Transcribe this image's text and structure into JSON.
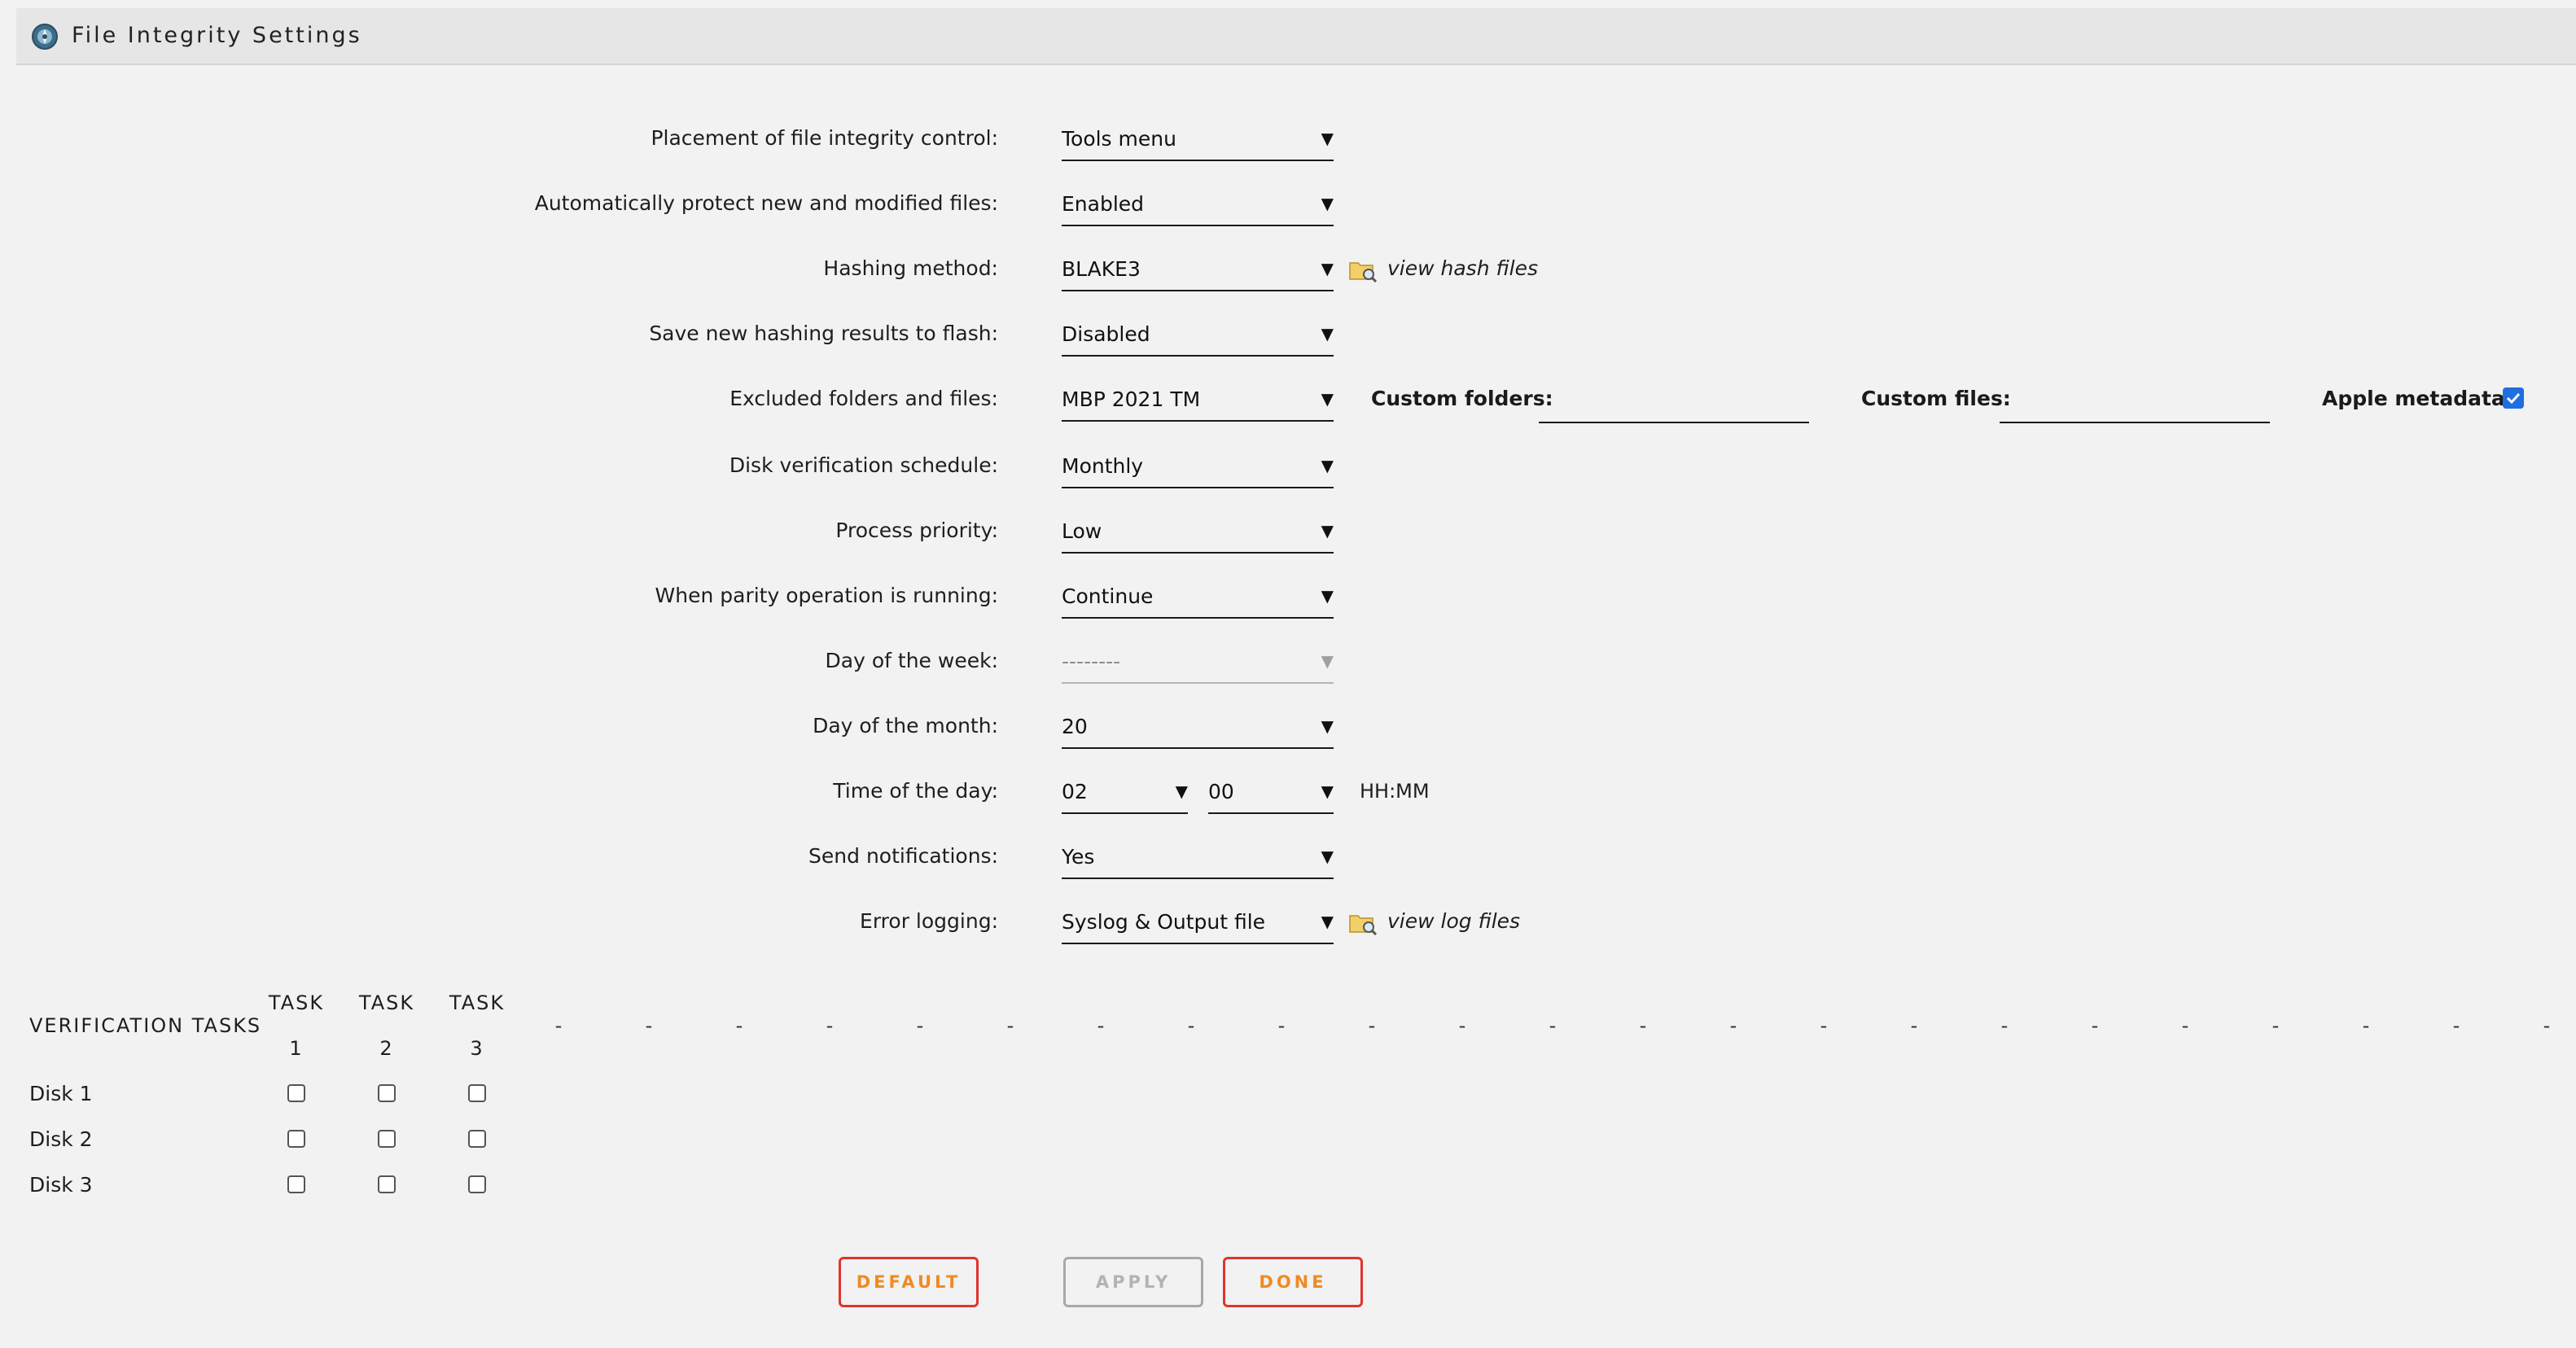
{
  "window": {
    "title": "File Integrity Settings",
    "icon": "gear-globe-icon"
  },
  "settings": [
    {
      "label": "Placement of file integrity control:",
      "value": "Tools menu"
    },
    {
      "label": "Automatically protect new and modified files:",
      "value": "Enabled"
    },
    {
      "label": "Hashing method:",
      "value": "BLAKE3",
      "link": "view hash files"
    },
    {
      "label": "Save new hashing results to flash:",
      "value": "Disabled"
    },
    {
      "label": "Excluded folders and files:",
      "value": "MBP 2021 TM"
    },
    {
      "label": "Disk verification schedule:",
      "value": "Monthly"
    },
    {
      "label": "Process priority:",
      "value": "Low"
    },
    {
      "label": "When parity operation is running:",
      "value": "Continue"
    },
    {
      "label": "Day of the week:",
      "value": "--------"
    },
    {
      "label": "Day of the month:",
      "value": "20"
    },
    {
      "label": "Time of the day:",
      "hour": "02",
      "minute": "00",
      "unit": "HH:MM"
    },
    {
      "label": "Send notifications:",
      "value": "Yes"
    },
    {
      "label": "Error logging:",
      "value": "Syslog & Output file",
      "link": "view log files"
    }
  ],
  "excluded": {
    "custom_folders_label": "Custom folders:",
    "custom_folders_value": "",
    "custom_files_label": "Custom files:",
    "custom_files_value": "",
    "apple_metadata_label": "Apple metadata:",
    "apple_metadata_checked": true
  },
  "verification": {
    "header": "VERIFICATION TASKS",
    "tasks": [
      {
        "top": "TASK",
        "num": "1"
      },
      {
        "top": "TASK",
        "num": "2"
      },
      {
        "top": "TASK",
        "num": "3"
      }
    ],
    "placeholder_dash": "-",
    "disks": [
      {
        "name": "Disk 1",
        "checks": [
          false,
          false,
          false
        ]
      },
      {
        "name": "Disk 2",
        "checks": [
          false,
          false,
          false
        ]
      },
      {
        "name": "Disk 3",
        "checks": [
          false,
          false,
          false
        ]
      }
    ]
  },
  "buttons": {
    "default": "DEFAULT",
    "apply": "APPLY",
    "done": "DONE"
  },
  "colors": {
    "button_border": "#e0342d",
    "button_text": "#f08a22",
    "checkbox_accent": "#1f6fe0"
  }
}
